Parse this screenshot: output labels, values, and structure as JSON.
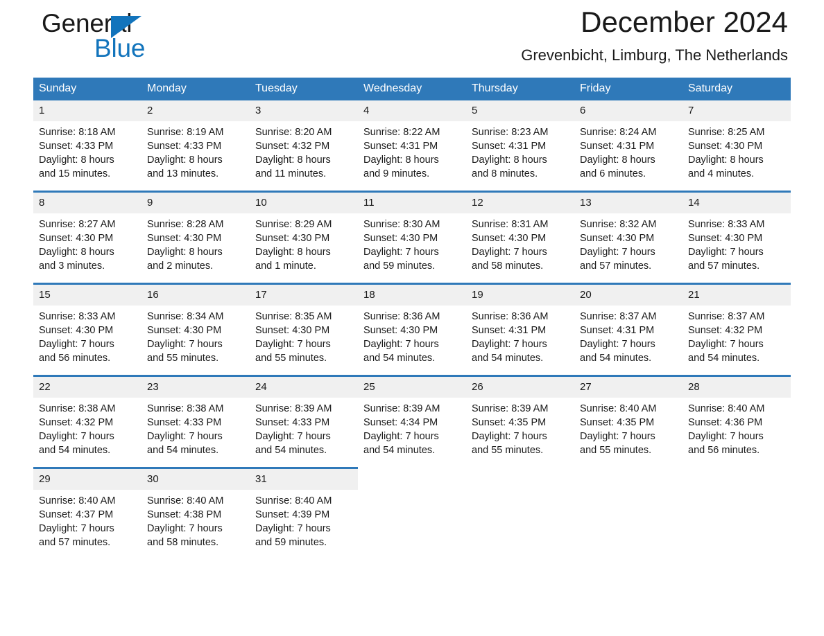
{
  "logo": {
    "line1": "General",
    "line2": "Blue",
    "triangle_color": "#1274bc",
    "text_color": "#1a1a1a"
  },
  "header": {
    "month_title": "December 2024",
    "location": "Grevenbicht, Limburg, The Netherlands"
  },
  "colors": {
    "header_blue": "#2f79b9",
    "daynum_band": "#f0f0f0",
    "cell_background": "#ffffff",
    "text": "#1a1a1a"
  },
  "weekday_headers": [
    "Sunday",
    "Monday",
    "Tuesday",
    "Wednesday",
    "Thursday",
    "Friday",
    "Saturday"
  ],
  "weeks": [
    [
      {
        "day": "1",
        "sunrise": "Sunrise: 8:18 AM",
        "sunset": "Sunset: 4:33 PM",
        "daylight1": "Daylight: 8 hours",
        "daylight2": "and 15 minutes."
      },
      {
        "day": "2",
        "sunrise": "Sunrise: 8:19 AM",
        "sunset": "Sunset: 4:33 PM",
        "daylight1": "Daylight: 8 hours",
        "daylight2": "and 13 minutes."
      },
      {
        "day": "3",
        "sunrise": "Sunrise: 8:20 AM",
        "sunset": "Sunset: 4:32 PM",
        "daylight1": "Daylight: 8 hours",
        "daylight2": "and 11 minutes."
      },
      {
        "day": "4",
        "sunrise": "Sunrise: 8:22 AM",
        "sunset": "Sunset: 4:31 PM",
        "daylight1": "Daylight: 8 hours",
        "daylight2": "and 9 minutes."
      },
      {
        "day": "5",
        "sunrise": "Sunrise: 8:23 AM",
        "sunset": "Sunset: 4:31 PM",
        "daylight1": "Daylight: 8 hours",
        "daylight2": "and 8 minutes."
      },
      {
        "day": "6",
        "sunrise": "Sunrise: 8:24 AM",
        "sunset": "Sunset: 4:31 PM",
        "daylight1": "Daylight: 8 hours",
        "daylight2": "and 6 minutes."
      },
      {
        "day": "7",
        "sunrise": "Sunrise: 8:25 AM",
        "sunset": "Sunset: 4:30 PM",
        "daylight1": "Daylight: 8 hours",
        "daylight2": "and 4 minutes."
      }
    ],
    [
      {
        "day": "8",
        "sunrise": "Sunrise: 8:27 AM",
        "sunset": "Sunset: 4:30 PM",
        "daylight1": "Daylight: 8 hours",
        "daylight2": "and 3 minutes."
      },
      {
        "day": "9",
        "sunrise": "Sunrise: 8:28 AM",
        "sunset": "Sunset: 4:30 PM",
        "daylight1": "Daylight: 8 hours",
        "daylight2": "and 2 minutes."
      },
      {
        "day": "10",
        "sunrise": "Sunrise: 8:29 AM",
        "sunset": "Sunset: 4:30 PM",
        "daylight1": "Daylight: 8 hours",
        "daylight2": "and 1 minute."
      },
      {
        "day": "11",
        "sunrise": "Sunrise: 8:30 AM",
        "sunset": "Sunset: 4:30 PM",
        "daylight1": "Daylight: 7 hours",
        "daylight2": "and 59 minutes."
      },
      {
        "day": "12",
        "sunrise": "Sunrise: 8:31 AM",
        "sunset": "Sunset: 4:30 PM",
        "daylight1": "Daylight: 7 hours",
        "daylight2": "and 58 minutes."
      },
      {
        "day": "13",
        "sunrise": "Sunrise: 8:32 AM",
        "sunset": "Sunset: 4:30 PM",
        "daylight1": "Daylight: 7 hours",
        "daylight2": "and 57 minutes."
      },
      {
        "day": "14",
        "sunrise": "Sunrise: 8:33 AM",
        "sunset": "Sunset: 4:30 PM",
        "daylight1": "Daylight: 7 hours",
        "daylight2": "and 57 minutes."
      }
    ],
    [
      {
        "day": "15",
        "sunrise": "Sunrise: 8:33 AM",
        "sunset": "Sunset: 4:30 PM",
        "daylight1": "Daylight: 7 hours",
        "daylight2": "and 56 minutes."
      },
      {
        "day": "16",
        "sunrise": "Sunrise: 8:34 AM",
        "sunset": "Sunset: 4:30 PM",
        "daylight1": "Daylight: 7 hours",
        "daylight2": "and 55 minutes."
      },
      {
        "day": "17",
        "sunrise": "Sunrise: 8:35 AM",
        "sunset": "Sunset: 4:30 PM",
        "daylight1": "Daylight: 7 hours",
        "daylight2": "and 55 minutes."
      },
      {
        "day": "18",
        "sunrise": "Sunrise: 8:36 AM",
        "sunset": "Sunset: 4:30 PM",
        "daylight1": "Daylight: 7 hours",
        "daylight2": "and 54 minutes."
      },
      {
        "day": "19",
        "sunrise": "Sunrise: 8:36 AM",
        "sunset": "Sunset: 4:31 PM",
        "daylight1": "Daylight: 7 hours",
        "daylight2": "and 54 minutes."
      },
      {
        "day": "20",
        "sunrise": "Sunrise: 8:37 AM",
        "sunset": "Sunset: 4:31 PM",
        "daylight1": "Daylight: 7 hours",
        "daylight2": "and 54 minutes."
      },
      {
        "day": "21",
        "sunrise": "Sunrise: 8:37 AM",
        "sunset": "Sunset: 4:32 PM",
        "daylight1": "Daylight: 7 hours",
        "daylight2": "and 54 minutes."
      }
    ],
    [
      {
        "day": "22",
        "sunrise": "Sunrise: 8:38 AM",
        "sunset": "Sunset: 4:32 PM",
        "daylight1": "Daylight: 7 hours",
        "daylight2": "and 54 minutes."
      },
      {
        "day": "23",
        "sunrise": "Sunrise: 8:38 AM",
        "sunset": "Sunset: 4:33 PM",
        "daylight1": "Daylight: 7 hours",
        "daylight2": "and 54 minutes."
      },
      {
        "day": "24",
        "sunrise": "Sunrise: 8:39 AM",
        "sunset": "Sunset: 4:33 PM",
        "daylight1": "Daylight: 7 hours",
        "daylight2": "and 54 minutes."
      },
      {
        "day": "25",
        "sunrise": "Sunrise: 8:39 AM",
        "sunset": "Sunset: 4:34 PM",
        "daylight1": "Daylight: 7 hours",
        "daylight2": "and 54 minutes."
      },
      {
        "day": "26",
        "sunrise": "Sunrise: 8:39 AM",
        "sunset": "Sunset: 4:35 PM",
        "daylight1": "Daylight: 7 hours",
        "daylight2": "and 55 minutes."
      },
      {
        "day": "27",
        "sunrise": "Sunrise: 8:40 AM",
        "sunset": "Sunset: 4:35 PM",
        "daylight1": "Daylight: 7 hours",
        "daylight2": "and 55 minutes."
      },
      {
        "day": "28",
        "sunrise": "Sunrise: 8:40 AM",
        "sunset": "Sunset: 4:36 PM",
        "daylight1": "Daylight: 7 hours",
        "daylight2": "and 56 minutes."
      }
    ],
    [
      {
        "day": "29",
        "sunrise": "Sunrise: 8:40 AM",
        "sunset": "Sunset: 4:37 PM",
        "daylight1": "Daylight: 7 hours",
        "daylight2": "and 57 minutes."
      },
      {
        "day": "30",
        "sunrise": "Sunrise: 8:40 AM",
        "sunset": "Sunset: 4:38 PM",
        "daylight1": "Daylight: 7 hours",
        "daylight2": "and 58 minutes."
      },
      {
        "day": "31",
        "sunrise": "Sunrise: 8:40 AM",
        "sunset": "Sunset: 4:39 PM",
        "daylight1": "Daylight: 7 hours",
        "daylight2": "and 59 minutes."
      },
      {
        "day": "",
        "sunrise": "",
        "sunset": "",
        "daylight1": "",
        "daylight2": ""
      },
      {
        "day": "",
        "sunrise": "",
        "sunset": "",
        "daylight1": "",
        "daylight2": ""
      },
      {
        "day": "",
        "sunrise": "",
        "sunset": "",
        "daylight1": "",
        "daylight2": ""
      },
      {
        "day": "",
        "sunrise": "",
        "sunset": "",
        "daylight1": "",
        "daylight2": ""
      }
    ]
  ]
}
